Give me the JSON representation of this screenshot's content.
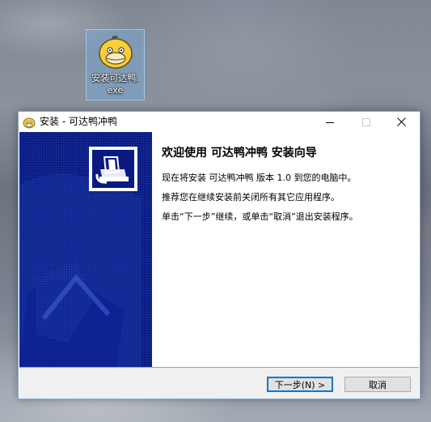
{
  "desktop": {
    "icon_label_line1": "安装可达鸭.",
    "icon_label_line2": "exe"
  },
  "window": {
    "title": "安装 - 可达鸭冲鸭",
    "heading": "欢迎使用 可达鸭冲鸭 安装向导",
    "line1": "现在将安装 可达鸭冲鸭 版本 1.0 到您的电脑中。",
    "line2": "推荐您在继续安装前关闭所有其它应用程序。",
    "line3": "单击“下一步”继续，或单击“取消”退出安装程序。",
    "buttons": {
      "next": "下一步(N) >",
      "cancel": "取消"
    }
  },
  "colors": {
    "side_panel": "#0a1a80",
    "accent_border": "#0078d7"
  }
}
